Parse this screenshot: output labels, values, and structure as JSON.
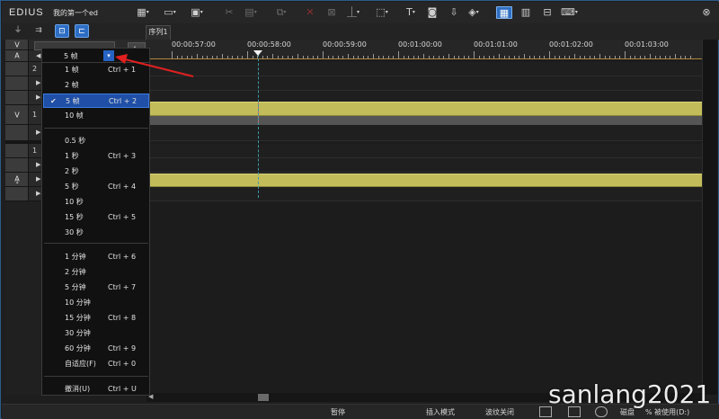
{
  "app": {
    "name": "EDIUS",
    "project": "我的第一个ed"
  },
  "window_controls": [
    "close-icon"
  ],
  "toolbar": {
    "icons": [
      "new-sequence-icon",
      "open-icon",
      "save-icon",
      "cut-icon",
      "paste-icon",
      "copy-icon",
      "delete-icon",
      "ripple-delete-icon",
      "marker-icon",
      "effects-icon",
      "title-icon",
      "capture-icon",
      "export-icon",
      "audio-icon",
      "timeline-grid-icon",
      "settings-icon",
      "keyboard-icon"
    ]
  },
  "mode_buttons": [
    "sync-lock-icon",
    "track-icon",
    "link-icon",
    "snap-icon"
  ],
  "sequence_tab": {
    "label": "序列1"
  },
  "timescale": {
    "current": "5 帧",
    "items": [
      {
        "label": "1 帧",
        "shortcut": "Ctrl + 1",
        "checked": false
      },
      {
        "label": "2 帧",
        "shortcut": "",
        "checked": false
      },
      {
        "label": "5 帧",
        "shortcut": "Ctrl + 2",
        "checked": true
      },
      {
        "label": "10 帧",
        "shortcut": "",
        "checked": false
      },
      {
        "label": "0.5 秒",
        "shortcut": "",
        "checked": false
      },
      {
        "label": "1 秒",
        "shortcut": "Ctrl + 3",
        "checked": false
      },
      {
        "label": "2 秒",
        "shortcut": "",
        "checked": false
      },
      {
        "label": "5 秒",
        "shortcut": "Ctrl + 4",
        "checked": false
      },
      {
        "label": "10 秒",
        "shortcut": "",
        "checked": false
      },
      {
        "label": "15 秒",
        "shortcut": "Ctrl + 5",
        "checked": false
      },
      {
        "label": "30 秒",
        "shortcut": "",
        "checked": false
      },
      {
        "label": "1 分钟",
        "shortcut": "Ctrl + 6",
        "checked": false
      },
      {
        "label": "2 分钟",
        "shortcut": "",
        "checked": false
      },
      {
        "label": "5 分钟",
        "shortcut": "Ctrl + 7",
        "checked": false
      },
      {
        "label": "10 分钟",
        "shortcut": "",
        "checked": false
      },
      {
        "label": "15 分钟",
        "shortcut": "Ctrl + 8",
        "checked": false
      },
      {
        "label": "30 分钟",
        "shortcut": "",
        "checked": false
      },
      {
        "label": "60 分钟",
        "shortcut": "Ctrl + 9",
        "checked": false
      },
      {
        "label": "自适应(F)",
        "shortcut": "Ctrl + 0",
        "checked": false
      },
      {
        "label": "撤消(U)",
        "shortcut": "Ctrl + U",
        "checked": false
      }
    ]
  },
  "tracks": {
    "top_labels": [
      "V",
      "A"
    ],
    "rows": [
      {
        "label": "",
        "num": "2"
      },
      {
        "label": "V",
        "num": "1"
      },
      {
        "label": "",
        "num": "1"
      },
      {
        "label": "A",
        "sub": "1",
        "num": ""
      }
    ]
  },
  "ruler": {
    "labels": [
      "00:00:57:00",
      "00:00:58:00",
      "00:00:59:00",
      "00:01:00:00",
      "00:01:01:00",
      "00:01:02:00",
      "00:01:03:00"
    ]
  },
  "status": {
    "state": "暂停",
    "insert_mode": "插入模式",
    "ripple": "波纹关闭",
    "disk": "磁盘",
    "disk_usage": "% 被使用(D:)"
  },
  "watermark": "sanlang2021"
}
